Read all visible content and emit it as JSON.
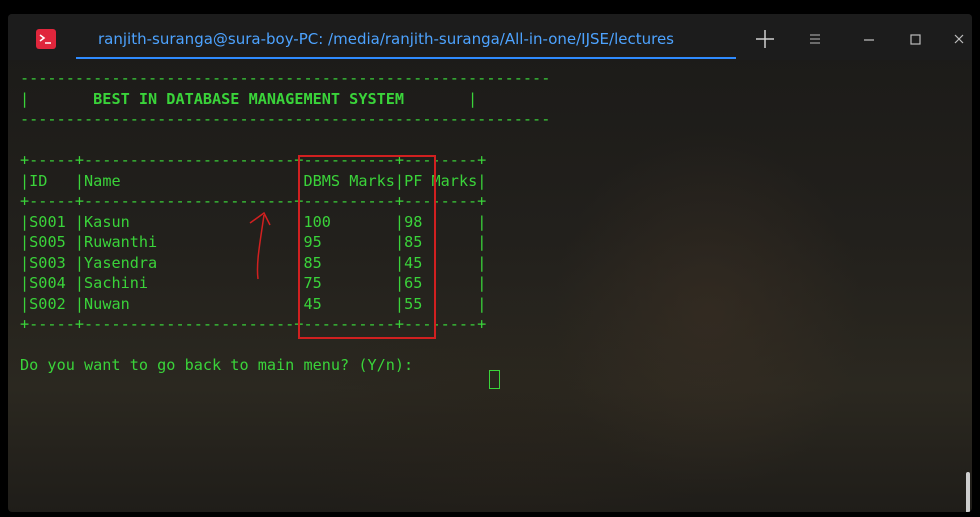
{
  "window": {
    "title": "ranjith-suranga@sura-boy-PC: /media/ranjith-suranga/All-in-one/IJSE/lectures",
    "buttons": [
      "new-tab",
      "menu",
      "minimize",
      "maximize",
      "close"
    ]
  },
  "terminal": {
    "banner_border": "----------------------------------------------------------",
    "banner_title": "BEST IN DATABASE MANAGEMENT SYSTEM",
    "table": {
      "columns": [
        "ID",
        "Name",
        "DBMS Marks",
        "PF Marks"
      ],
      "rows": [
        [
          "S001",
          "Kasun",
          "100",
          "98"
        ],
        [
          "S005",
          "Ruwanthi",
          "95",
          "85"
        ],
        [
          "S003",
          "Yasendra",
          "85",
          "45"
        ],
        [
          "S004",
          "Sachini",
          "75",
          "65"
        ],
        [
          "S002",
          "Nuwan",
          "45",
          "55"
        ]
      ]
    },
    "prompt": "Do you want to go back to main menu? (Y/n): "
  },
  "colors": {
    "terminal_text": "#3ad33a",
    "title_text": "#4da3ff",
    "annotation": "#d12020",
    "app_icon": "#e0263c"
  }
}
